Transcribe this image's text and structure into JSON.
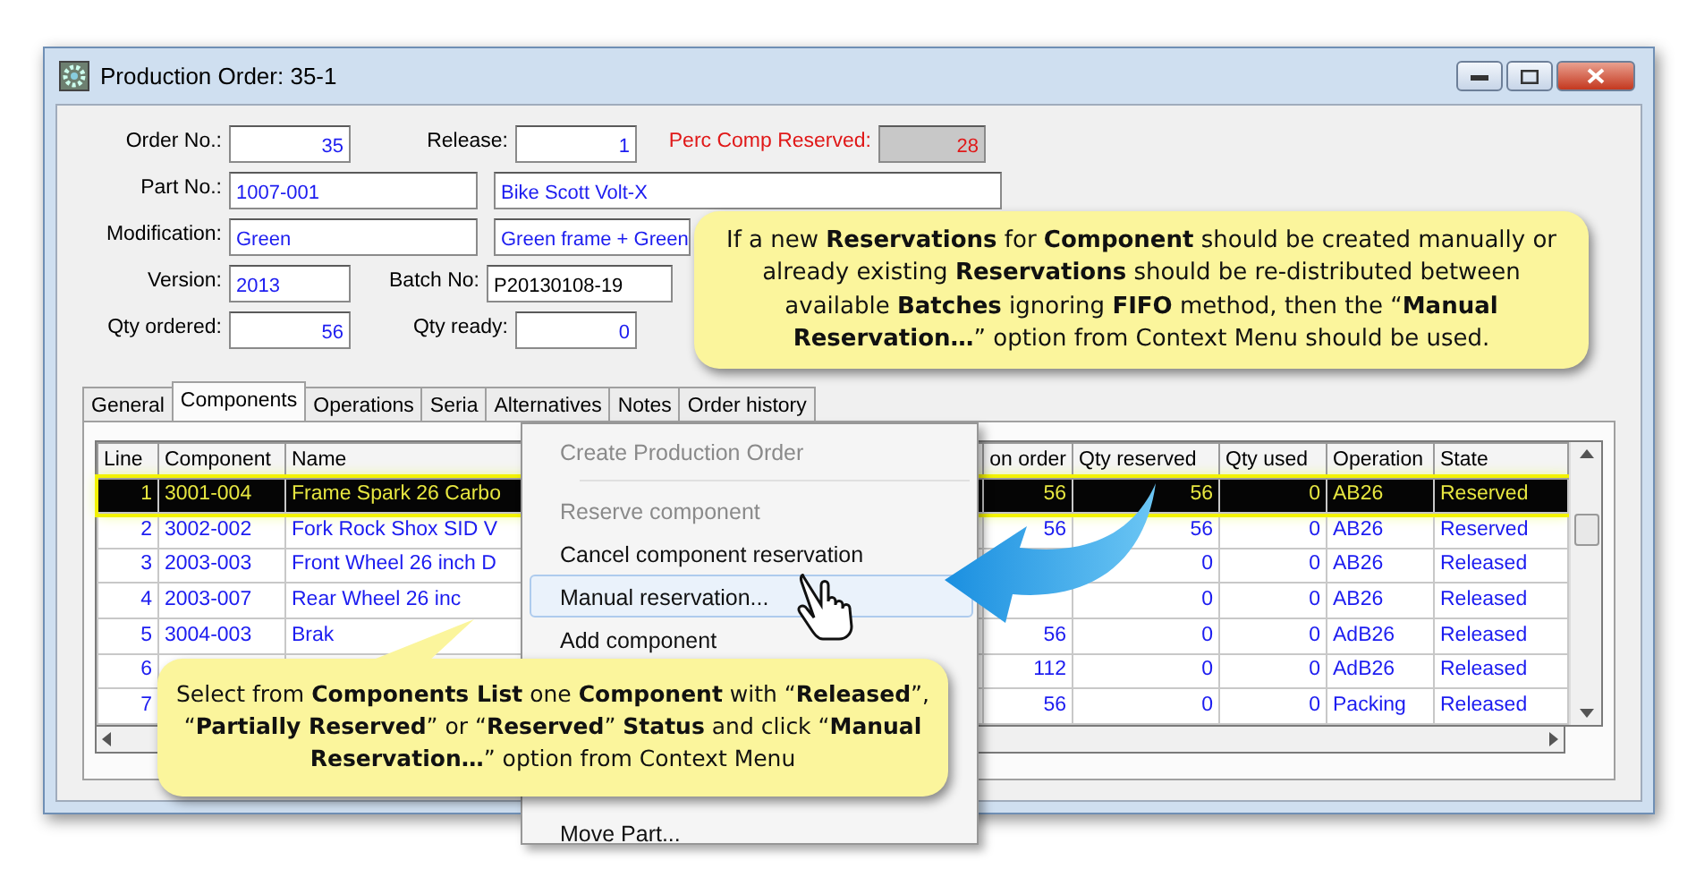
{
  "window": {
    "title": "Production Order: 35-1"
  },
  "form": [
    [
      {
        "label": "Order No.:",
        "value": "35",
        "kind": "number"
      },
      {
        "label": "Release:",
        "value": "1",
        "kind": "number"
      },
      {
        "label": "Perc Comp Reserved:",
        "value": "28",
        "kind": "readonly"
      }
    ],
    [
      {
        "label": "Part No.:",
        "value": "1007-001",
        "kind": "text"
      },
      {
        "value": "Bike Scott Volt-X",
        "kind": "wide"
      }
    ],
    [
      {
        "label": "Modification:",
        "value": "Green",
        "kind": "text"
      },
      {
        "value": "Green frame + Green",
        "kind": "wide"
      }
    ],
    [
      {
        "label": "Version:",
        "value": "2013",
        "kind": "short"
      },
      {
        "label": "Batch No:",
        "value": "P20130108-19",
        "kind": "plain"
      }
    ],
    [
      {
        "label": "Qty ordered:",
        "value": "56",
        "kind": "number"
      },
      {
        "label": "Qty ready:",
        "value": "0",
        "kind": "number"
      }
    ]
  ],
  "tabs": [
    {
      "label": "General",
      "selected": false
    },
    {
      "label": "Components",
      "selected": true
    },
    {
      "label": "Operations",
      "selected": false
    },
    {
      "label": "Seria",
      "selected": false
    },
    {
      "label": "Alternatives",
      "selected": false
    },
    {
      "label": "Notes",
      "selected": false
    },
    {
      "label": "Order history",
      "selected": false
    }
  ],
  "table": {
    "columns": [
      "Line",
      "Component",
      "Name",
      "on order",
      "Qty reserved",
      "Qty used",
      "Operation",
      "State"
    ],
    "rows": [
      {
        "line": "1",
        "component": "3001-004",
        "name": "Frame Spark 26 Carbo",
        "on_order": "56",
        "qty_reserved": "56",
        "qty_used": "0",
        "operation": "AB26",
        "state": "Reserved",
        "selected": true
      },
      {
        "line": "2",
        "component": "3002-002",
        "name": "Fork Rock Shox SID V",
        "on_order": "56",
        "qty_reserved": "56",
        "qty_used": "0",
        "operation": "AB26",
        "state": "Reserved",
        "selected": false
      },
      {
        "line": "3",
        "component": "2003-003",
        "name": "Front Wheel 26 inch D",
        "qty_reserved": "0",
        "qty_used": "0",
        "operation": "AB26",
        "state": "Released",
        "selected": false
      },
      {
        "line": "4",
        "component": "2003-007",
        "name": "Rear Wheel 26 inc",
        "qty_reserved": "0",
        "qty_used": "0",
        "operation": "AB26",
        "state": "Released",
        "selected": false
      },
      {
        "line": "5",
        "component": "3004-003",
        "name": "Brak",
        "on_order": "56",
        "qty_reserved": "0",
        "qty_used": "0",
        "operation": "AdB26",
        "state": "Released",
        "selected": false
      },
      {
        "line": "6",
        "on_order": "112",
        "qty_reserved": "0",
        "qty_used": "0",
        "operation": "AdB26",
        "state": "Released",
        "selected": false
      },
      {
        "line": "7",
        "on_order": "56",
        "qty_reserved": "0",
        "qty_used": "0",
        "operation": "Packing",
        "state": "Released",
        "selected": false
      }
    ]
  },
  "context_menu": [
    {
      "kind": "item",
      "label": "Create Production Order",
      "disabled": true,
      "selected": false
    },
    {
      "kind": "separator"
    },
    {
      "kind": "item",
      "label": "Reserve component",
      "disabled": true,
      "selected": false
    },
    {
      "kind": "item",
      "label": "Cancel component reservation",
      "disabled": false,
      "selected": false
    },
    {
      "kind": "item",
      "label": "Manual reservation...",
      "disabled": false,
      "selected": true
    },
    {
      "kind": "item",
      "label": "Add component",
      "disabled": false,
      "selected": false
    },
    {
      "kind": "gap"
    },
    {
      "kind": "item",
      "label": "Move Part...",
      "disabled": false,
      "selected": false
    }
  ],
  "callouts": [
    {
      "text": "If a new **Reservations** for **Component** should be created manually or already existing **Reservations** should be re-distributed between available **Batches** ignoring **FIFO** method, then the “**Manual Reservation…**” option from Context Menu should be used."
    },
    {
      "text": "Select from **Components List** one **Component** with “**Released**”, “**Partially Reserved**” or “**Reserved**” **Status** and click “**Manual Reservation…**” option from Context Menu"
    }
  ]
}
